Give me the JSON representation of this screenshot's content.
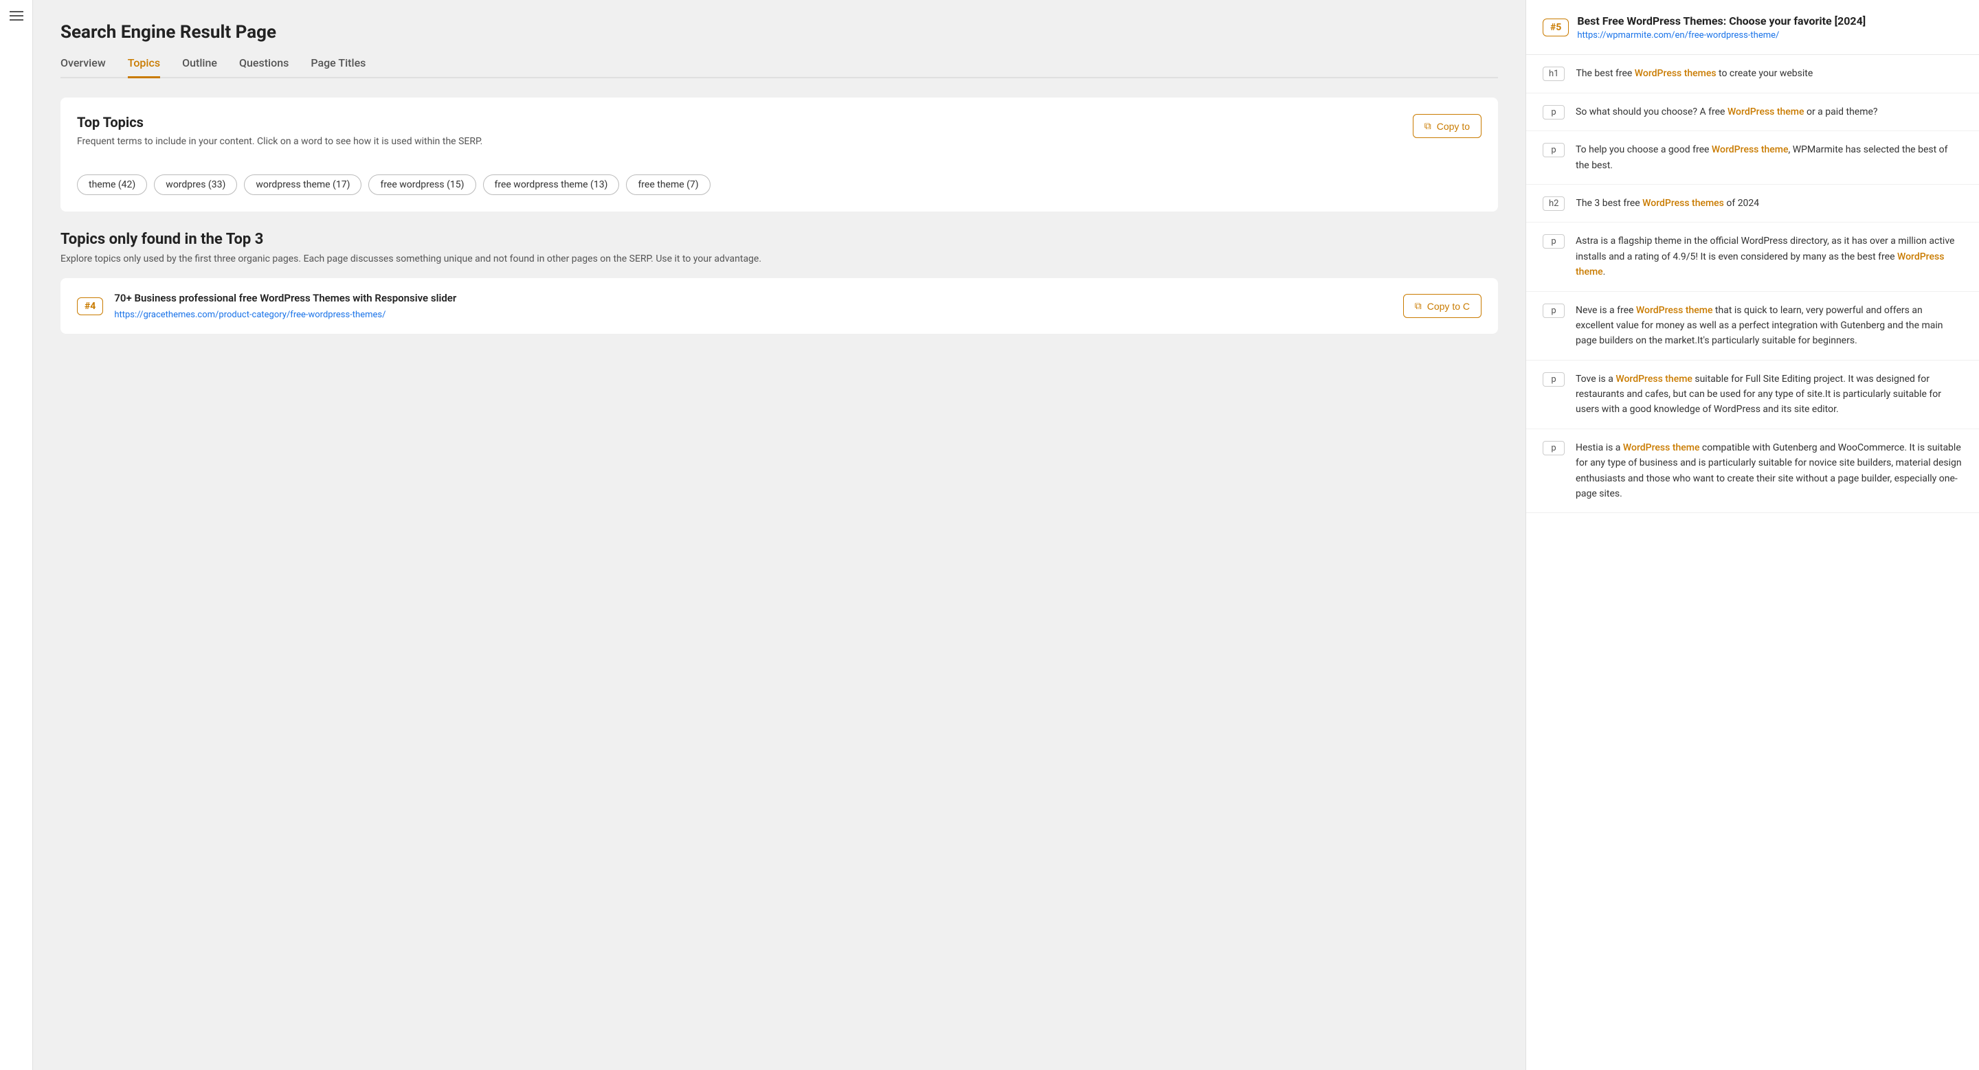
{
  "app": {
    "page_title": "Search Engine Result Page"
  },
  "tabs": [
    {
      "id": "overview",
      "label": "Overview",
      "active": false
    },
    {
      "id": "topics",
      "label": "Topics",
      "active": true
    },
    {
      "id": "outline",
      "label": "Outline",
      "active": false
    },
    {
      "id": "questions",
      "label": "Questions",
      "active": false
    },
    {
      "id": "page-titles",
      "label": "Page Titles",
      "active": false
    }
  ],
  "top_topics": {
    "title": "Top Topics",
    "description": "Frequent terms to include in your content. Click on a word to see how it is used within the SERP.",
    "copy_button_label": "Copy to",
    "tags": [
      {
        "label": "theme (42)"
      },
      {
        "label": "wordpres (33)"
      },
      {
        "label": "wordpress theme (17)"
      },
      {
        "label": "free wordpress (15)"
      },
      {
        "label": "free wordpress theme (13)"
      },
      {
        "label": "free theme (7)"
      }
    ]
  },
  "top3": {
    "title": "Topics only found in the Top 3",
    "description": "Explore topics only used by the first three organic pages. Each page discusses something unique and not found in other pages on the SERP. Use it to your advantage.",
    "card": {
      "number": "#4",
      "title": "70+ Business professional free WordPress Themes with Responsive slider",
      "url": "https://gracethemes.com/product-category/free-wordpress-themes/",
      "copy_button_label": "Copy to C"
    }
  },
  "right_panel": {
    "result_number": "#5",
    "title": "Best Free WordPress Themes: Choose your favorite [2024]",
    "url": "https://wpmarmite.com/en/free-wordpress-theme/",
    "items": [
      {
        "tag": "h1",
        "text_parts": [
          {
            "text": "The best free ",
            "highlight": false
          },
          {
            "text": "WordPress themes",
            "highlight": true
          },
          {
            "text": " to create your website",
            "highlight": false
          }
        ]
      },
      {
        "tag": "p",
        "text_parts": [
          {
            "text": "So what should you choose? A free ",
            "highlight": false
          },
          {
            "text": "WordPress theme",
            "highlight": true
          },
          {
            "text": " or a paid theme?",
            "highlight": false
          }
        ]
      },
      {
        "tag": "p",
        "text_parts": [
          {
            "text": "To help you choose a good free ",
            "highlight": false
          },
          {
            "text": "WordPress theme",
            "highlight": true
          },
          {
            "text": ", WPMarmite has selected the best of the best.",
            "highlight": false
          }
        ]
      },
      {
        "tag": "h2",
        "text_parts": [
          {
            "text": "The 3 best free ",
            "highlight": false
          },
          {
            "text": "WordPress themes",
            "highlight": true
          },
          {
            "text": " of 2024",
            "highlight": false
          }
        ]
      },
      {
        "tag": "p",
        "text_parts": [
          {
            "text": "Astra is a flagship theme in the official WordPress directory, as it has over a million active installs and a rating of 4.9/5! It is even considered by many as the best free ",
            "highlight": false
          },
          {
            "text": "WordPress theme",
            "highlight": true
          },
          {
            "text": ".",
            "highlight": false
          }
        ]
      },
      {
        "tag": "p",
        "text_parts": [
          {
            "text": "Neve is a free ",
            "highlight": false
          },
          {
            "text": "WordPress theme",
            "highlight": true
          },
          {
            "text": " that is quick to learn, very powerful and offers an excellent value for money as well as a perfect integration with Gutenberg and the main page builders on the market.It's particularly suitable for beginners.",
            "highlight": false
          }
        ]
      },
      {
        "tag": "p",
        "text_parts": [
          {
            "text": "Tove is a ",
            "highlight": false
          },
          {
            "text": "WordPress theme",
            "highlight": true
          },
          {
            "text": " suitable for Full Site Editing project. It was designed for restaurants and cafes, but can be used for any type of site.It is particularly suitable for users with a good knowledge of WordPress and its site editor.",
            "highlight": false
          }
        ]
      },
      {
        "tag": "p",
        "text_parts": [
          {
            "text": "Hestia is a ",
            "highlight": false
          },
          {
            "text": "WordPress theme",
            "highlight": true
          },
          {
            "text": " compatible with Gutenberg and WooCommerce. It is suitable for any type of business and is particularly suitable for novice site builders, material design enthusiasts and those who want to create their site without a page builder, especially one-page sites.",
            "highlight": false
          }
        ]
      }
    ]
  },
  "icons": {
    "hamburger": "☰",
    "copy": "⧉"
  }
}
